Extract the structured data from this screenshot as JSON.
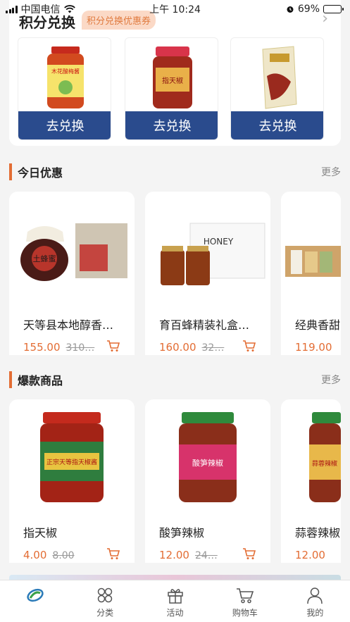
{
  "status_bar": {
    "carrier": "中国电信",
    "time": "上午 10:24",
    "battery_pct": "69%",
    "battery_level": 0.69,
    "signal_icon": "signal-icon",
    "wifi_icon": "wifi-icon",
    "alarm_icon": "alarm-icon"
  },
  "points": {
    "title": "积分兑换",
    "coupon_tag": "积分兑换优惠券",
    "items": [
      {
        "button": "去兑换",
        "image_text": "木花酸梅酱"
      },
      {
        "button": "去兑换",
        "image_text": "指天椒"
      },
      {
        "button": "去兑换",
        "image_text": ""
      }
    ]
  },
  "today": {
    "title": "今日优惠",
    "more": "更多",
    "products": [
      {
        "name": "天等县本地醇香…",
        "price": "155.00",
        "orig_price": "310…",
        "image_text": "土蜂蜜"
      },
      {
        "name": "育百蜂精装礼盒…",
        "price": "160.00",
        "orig_price": "32…",
        "image_text": "HONEY"
      },
      {
        "name": "经典香甜",
        "price": "119.00",
        "orig_price": "",
        "image_text": ""
      }
    ]
  },
  "hot": {
    "title": "爆款商品",
    "more": "更多",
    "products": [
      {
        "name": "指天椒",
        "price": "4.00",
        "orig_price": "8.00",
        "image_text": "正宗天等指天椒酱"
      },
      {
        "name": "酸笋辣椒",
        "price": "12.00",
        "orig_price": "24…",
        "image_text": "酸笋辣椒"
      },
      {
        "name": "蒜蓉辣椒",
        "price": "12.00",
        "orig_price": "",
        "image_text": "蒜蓉辣椒"
      }
    ]
  },
  "tabs": [
    {
      "label": "",
      "icon": "home-logo-icon"
    },
    {
      "label": "分类",
      "icon": "category-icon"
    },
    {
      "label": "活动",
      "icon": "gift-icon"
    },
    {
      "label": "购物车",
      "icon": "cart-icon"
    },
    {
      "label": "我的",
      "icon": "user-icon"
    }
  ],
  "colors": {
    "accent": "#e36d34",
    "button_blue": "#2a4b8d",
    "tag_bg": "#fbd9c6",
    "active_tab": "#1f7a6e"
  }
}
